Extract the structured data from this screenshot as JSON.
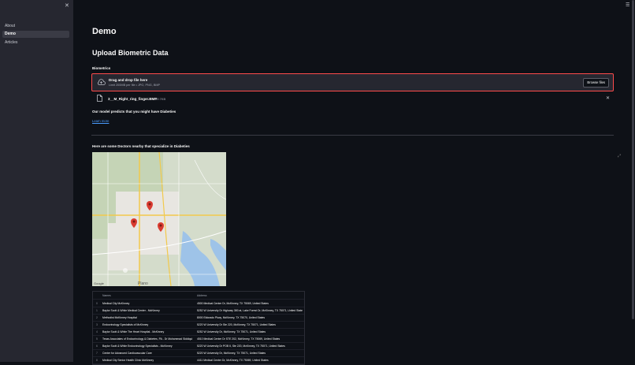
{
  "sidebar": {
    "close_icon": "close-icon",
    "items": [
      {
        "label": "About"
      },
      {
        "label": "Demo"
      },
      {
        "label": "Articles"
      }
    ]
  },
  "header": {
    "menu_icon": "hamburger-icon"
  },
  "main": {
    "title": "Demo",
    "subtitle": "Upload Biometric Data",
    "uploader_label": "Biometrics",
    "drag_text": "Drag and drop file here",
    "limit_text": "Limit 200MB per file • JPG, PNG, BMP",
    "browse_label": "Browse files",
    "file_name": "3__M_Right_ring_finger.BMP",
    "file_size": "39.7KB",
    "prediction": "Our model predicts that you might have Diabeties",
    "learn_more": "Learn more",
    "doctors_heading": "Here are some Doctors nearby that specialize in Diabeties",
    "map_credit": "Google",
    "map_place": "Plano"
  },
  "table": {
    "headers": {
      "name": "Names",
      "address": "Address"
    },
    "rows": [
      {
        "idx": "0",
        "name": "Medical City McKinney",
        "address": "4500 Medical Center Dr, McKinney, TX 75069, United States"
      },
      {
        "idx": "1",
        "name": "Baylor Scott & White Medical Center - McKinney",
        "address": "5252 W University Dr Highway 380 at, Lake Forest Dr, McKinney, TX 75071, United States"
      },
      {
        "idx": "2",
        "name": "Methodist McKinney Hospital",
        "address": "8000 Eldorado Pkwy, McKinney, TX 75070, United States"
      },
      {
        "idx": "3",
        "name": "Endocrinology Specialists of McKinney",
        "address": "5220 W University Dr Ste 220, McKinney, TX 75071, United States"
      },
      {
        "idx": "4",
        "name": "Baylor Scott & White The Heart Hospital - McKinney",
        "address": "5252 W University Dr, McKinney, TX 75071, United States"
      },
      {
        "idx": "5",
        "name": "Texas Associates of Endocrinology & Diabetes, PA - Dr Muhammad Siddiqui",
        "address": "4510 Medical Center Dr STE 202, McKinney, TX 75069, United States"
      },
      {
        "idx": "6",
        "name": "Baylor Scott & White Endocrinology Specialists - McKinney",
        "address": "5220 W University Dr POB II, Ste 220, McKinney, TX 75071, United States"
      },
      {
        "idx": "7",
        "name": "Center for Advanced Cardiovascular Care",
        "address": "5220 W University Dr, McKinney, TX 75071, United States"
      },
      {
        "idx": "8",
        "name": "Medical City Senior Health Clinic McKinney",
        "address": "4411 Medical Center Dr, McKinney, TX 75069, United States"
      }
    ]
  },
  "colors": {
    "accent": "#ff4b4b",
    "link": "#4a9cff",
    "sidebar_bg": "#262730",
    "app_bg": "#0e1117",
    "pin": "#d93b30"
  }
}
